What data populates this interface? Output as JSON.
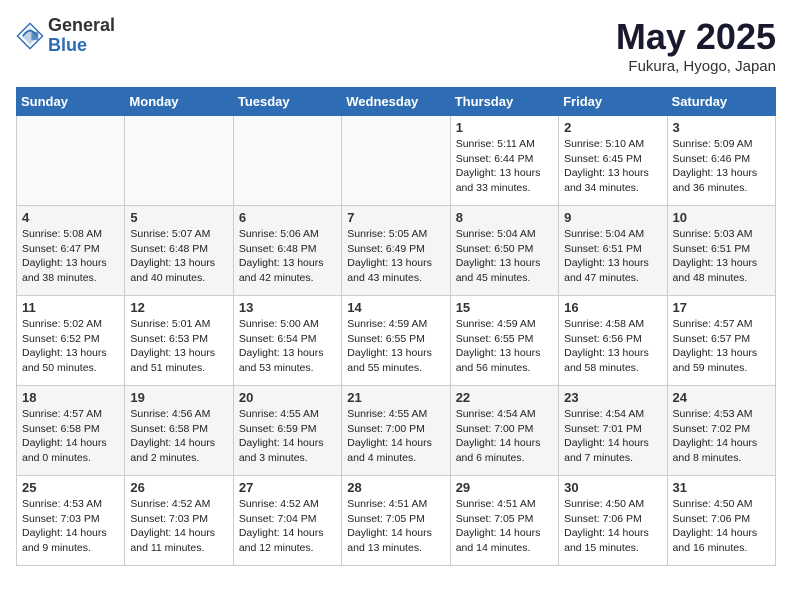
{
  "header": {
    "logo_general": "General",
    "logo_blue": "Blue",
    "month": "May 2025",
    "location": "Fukura, Hyogo, Japan"
  },
  "weekdays": [
    "Sunday",
    "Monday",
    "Tuesday",
    "Wednesday",
    "Thursday",
    "Friday",
    "Saturday"
  ],
  "weeks": [
    [
      {
        "day": "",
        "info": ""
      },
      {
        "day": "",
        "info": ""
      },
      {
        "day": "",
        "info": ""
      },
      {
        "day": "",
        "info": ""
      },
      {
        "day": "1",
        "info": "Sunrise: 5:11 AM\nSunset: 6:44 PM\nDaylight: 13 hours\nand 33 minutes."
      },
      {
        "day": "2",
        "info": "Sunrise: 5:10 AM\nSunset: 6:45 PM\nDaylight: 13 hours\nand 34 minutes."
      },
      {
        "day": "3",
        "info": "Sunrise: 5:09 AM\nSunset: 6:46 PM\nDaylight: 13 hours\nand 36 minutes."
      }
    ],
    [
      {
        "day": "4",
        "info": "Sunrise: 5:08 AM\nSunset: 6:47 PM\nDaylight: 13 hours\nand 38 minutes."
      },
      {
        "day": "5",
        "info": "Sunrise: 5:07 AM\nSunset: 6:48 PM\nDaylight: 13 hours\nand 40 minutes."
      },
      {
        "day": "6",
        "info": "Sunrise: 5:06 AM\nSunset: 6:48 PM\nDaylight: 13 hours\nand 42 minutes."
      },
      {
        "day": "7",
        "info": "Sunrise: 5:05 AM\nSunset: 6:49 PM\nDaylight: 13 hours\nand 43 minutes."
      },
      {
        "day": "8",
        "info": "Sunrise: 5:04 AM\nSunset: 6:50 PM\nDaylight: 13 hours\nand 45 minutes."
      },
      {
        "day": "9",
        "info": "Sunrise: 5:04 AM\nSunset: 6:51 PM\nDaylight: 13 hours\nand 47 minutes."
      },
      {
        "day": "10",
        "info": "Sunrise: 5:03 AM\nSunset: 6:51 PM\nDaylight: 13 hours\nand 48 minutes."
      }
    ],
    [
      {
        "day": "11",
        "info": "Sunrise: 5:02 AM\nSunset: 6:52 PM\nDaylight: 13 hours\nand 50 minutes."
      },
      {
        "day": "12",
        "info": "Sunrise: 5:01 AM\nSunset: 6:53 PM\nDaylight: 13 hours\nand 51 minutes."
      },
      {
        "day": "13",
        "info": "Sunrise: 5:00 AM\nSunset: 6:54 PM\nDaylight: 13 hours\nand 53 minutes."
      },
      {
        "day": "14",
        "info": "Sunrise: 4:59 AM\nSunset: 6:55 PM\nDaylight: 13 hours\nand 55 minutes."
      },
      {
        "day": "15",
        "info": "Sunrise: 4:59 AM\nSunset: 6:55 PM\nDaylight: 13 hours\nand 56 minutes."
      },
      {
        "day": "16",
        "info": "Sunrise: 4:58 AM\nSunset: 6:56 PM\nDaylight: 13 hours\nand 58 minutes."
      },
      {
        "day": "17",
        "info": "Sunrise: 4:57 AM\nSunset: 6:57 PM\nDaylight: 13 hours\nand 59 minutes."
      }
    ],
    [
      {
        "day": "18",
        "info": "Sunrise: 4:57 AM\nSunset: 6:58 PM\nDaylight: 14 hours\nand 0 minutes."
      },
      {
        "day": "19",
        "info": "Sunrise: 4:56 AM\nSunset: 6:58 PM\nDaylight: 14 hours\nand 2 minutes."
      },
      {
        "day": "20",
        "info": "Sunrise: 4:55 AM\nSunset: 6:59 PM\nDaylight: 14 hours\nand 3 minutes."
      },
      {
        "day": "21",
        "info": "Sunrise: 4:55 AM\nSunset: 7:00 PM\nDaylight: 14 hours\nand 4 minutes."
      },
      {
        "day": "22",
        "info": "Sunrise: 4:54 AM\nSunset: 7:00 PM\nDaylight: 14 hours\nand 6 minutes."
      },
      {
        "day": "23",
        "info": "Sunrise: 4:54 AM\nSunset: 7:01 PM\nDaylight: 14 hours\nand 7 minutes."
      },
      {
        "day": "24",
        "info": "Sunrise: 4:53 AM\nSunset: 7:02 PM\nDaylight: 14 hours\nand 8 minutes."
      }
    ],
    [
      {
        "day": "25",
        "info": "Sunrise: 4:53 AM\nSunset: 7:03 PM\nDaylight: 14 hours\nand 9 minutes."
      },
      {
        "day": "26",
        "info": "Sunrise: 4:52 AM\nSunset: 7:03 PM\nDaylight: 14 hours\nand 11 minutes."
      },
      {
        "day": "27",
        "info": "Sunrise: 4:52 AM\nSunset: 7:04 PM\nDaylight: 14 hours\nand 12 minutes."
      },
      {
        "day": "28",
        "info": "Sunrise: 4:51 AM\nSunset: 7:05 PM\nDaylight: 14 hours\nand 13 minutes."
      },
      {
        "day": "29",
        "info": "Sunrise: 4:51 AM\nSunset: 7:05 PM\nDaylight: 14 hours\nand 14 minutes."
      },
      {
        "day": "30",
        "info": "Sunrise: 4:50 AM\nSunset: 7:06 PM\nDaylight: 14 hours\nand 15 minutes."
      },
      {
        "day": "31",
        "info": "Sunrise: 4:50 AM\nSunset: 7:06 PM\nDaylight: 14 hours\nand 16 minutes."
      }
    ]
  ]
}
